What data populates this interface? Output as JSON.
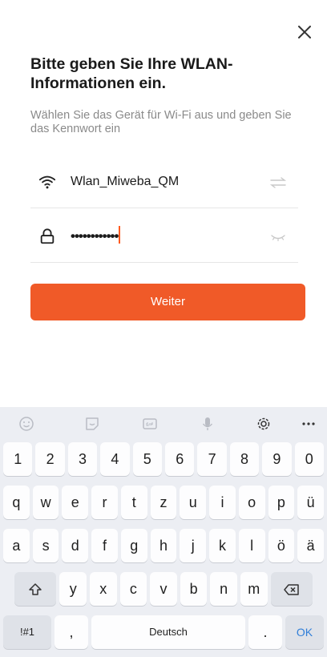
{
  "header": {
    "title": "Bitte geben Sie Ihre WLAN-Informationen ein.",
    "subtitle": "Wählen Sie das Gerät für Wi-Fi aus und geben Sie das Kennwort ein"
  },
  "wifi": {
    "ssid": "Wlan_Miweba_QM"
  },
  "password": {
    "masked_value": "••••••••••••"
  },
  "actions": {
    "next_label": "Weiter"
  },
  "keyboard": {
    "toolbar_icons": [
      "emoji-icon",
      "sticker-icon",
      "gif-icon",
      "microphone-icon",
      "settings-icon",
      "more-icon"
    ],
    "row1": [
      "1",
      "2",
      "3",
      "4",
      "5",
      "6",
      "7",
      "8",
      "9",
      "0"
    ],
    "row2": [
      "q",
      "w",
      "e",
      "r",
      "t",
      "z",
      "u",
      "i",
      "o",
      "p",
      "ü"
    ],
    "row3": [
      "a",
      "s",
      "d",
      "f",
      "g",
      "h",
      "j",
      "k",
      "l",
      "ö",
      "ä"
    ],
    "row4": [
      "y",
      "x",
      "c",
      "v",
      "b",
      "n",
      "m"
    ],
    "symbols_label": "!#1",
    "comma_label": ",",
    "space_label": "Deutsch",
    "period_label": ".",
    "ok_label": "OK"
  },
  "colors": {
    "accent": "#f05a28",
    "ok_blue": "#2f7ed8"
  }
}
